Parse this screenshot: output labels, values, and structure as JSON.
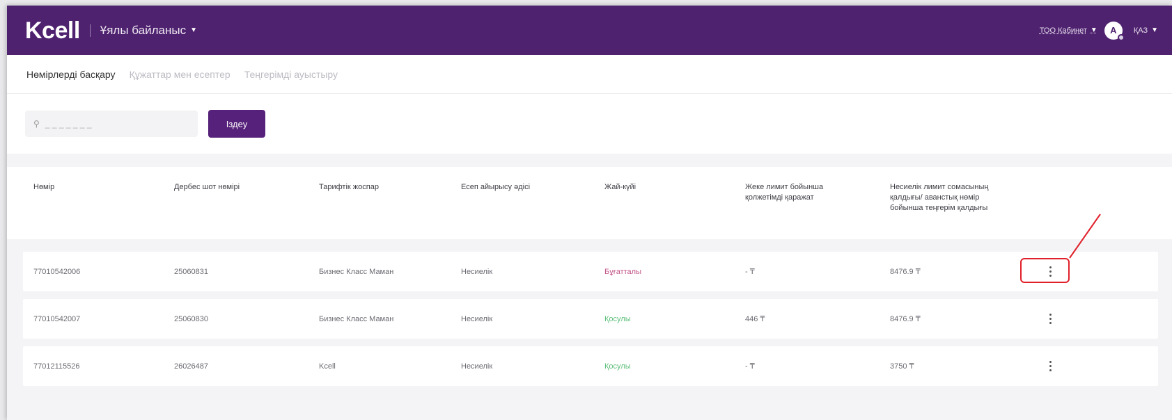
{
  "header": {
    "logo": "Kcell",
    "service": "Ұялы байланыс",
    "cabinet": "ТОО Кабинет",
    "avatar_initial": "А",
    "language": "ҚАЗ"
  },
  "tabs": [
    {
      "label": "Нөмірлерді басқару",
      "active": true
    },
    {
      "label": "Құжаттар мен есептер",
      "active": false
    },
    {
      "label": "Теңгерімді ауыстыру",
      "active": false
    }
  ],
  "search": {
    "placeholder": "_ _ _ _ _ _ _",
    "button_label": "Іздеу"
  },
  "table": {
    "columns": [
      "Нөмір",
      "Дербес шот нөмірі",
      "Тарифтік жоспар",
      "Есеп айырысу әдісі",
      "Жай-күйі",
      "Жеке лимит бойынша қолжетімді қаражат",
      "Несиелік лимит сомасының қалдығы/ аванстық нөмір бойынша теңгерім қалдығы"
    ],
    "rows": [
      {
        "number": "77010542006",
        "account": "25060831",
        "tariff": "Бизнес Класс Маман",
        "method": "Несиелік",
        "status": "Бұғатталы",
        "status_type": "blocked",
        "limit": "- ₸",
        "balance": "8476.9 ₸"
      },
      {
        "number": "77010542007",
        "account": "25060830",
        "tariff": "Бизнес Класс Маман",
        "method": "Несиелік",
        "status": "Қосулы",
        "status_type": "on",
        "limit": "446 ₸",
        "balance": "8476.9 ₸"
      },
      {
        "number": "77012115526",
        "account": "26026487",
        "tariff": "Kcell",
        "method": "Несиелік",
        "status": "Қосулы",
        "status_type": "on",
        "limit": "- ₸",
        "balance": "3750 ₸"
      }
    ]
  },
  "colors": {
    "brand": "#4f2270",
    "button": "#56217a",
    "status_blocked": "#c2568a",
    "status_on": "#5cbf7a",
    "highlight": "#e0202a"
  },
  "icons": {
    "search": "search-icon",
    "row_menu": "more-vertical-icon",
    "dropdown": "chevron-down-icon"
  }
}
